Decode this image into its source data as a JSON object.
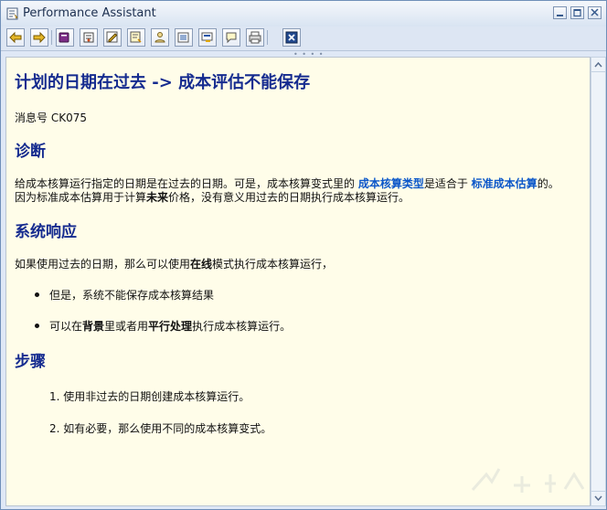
{
  "window": {
    "title": "Performance Assistant"
  },
  "toolbar": {
    "buttons": [
      {
        "name": "back-button",
        "icon": "left-arrow-icon"
      },
      {
        "name": "forward-button",
        "icon": "right-arrow-icon"
      },
      {
        "name": "bookmark-button",
        "icon": "book-icon"
      },
      {
        "name": "settings-button",
        "icon": "tools-icon"
      },
      {
        "name": "edit-button",
        "icon": "pencil-icon"
      },
      {
        "name": "notes-button",
        "icon": "note-icon"
      },
      {
        "name": "info-button",
        "icon": "person-icon"
      },
      {
        "name": "document-button",
        "icon": "doc-icon"
      },
      {
        "name": "link-button",
        "icon": "link-icon"
      },
      {
        "name": "message-button",
        "icon": "chat-icon"
      },
      {
        "name": "print-button",
        "icon": "printer-icon"
      },
      {
        "name": "close-button",
        "icon": "close-icon"
      }
    ]
  },
  "content": {
    "title": "计划的日期在过去 -> 成本评估不能保存",
    "message_id": "消息号 CK075",
    "diagnosis": {
      "heading": "诊断",
      "line1_pre": "给成本核算运行指定的日期是在过去的日期。可是，成本核算变式里的 ",
      "line1_link1": "成本核算类型",
      "line1_mid": "是适合于 ",
      "line1_link2": "标准成本估算",
      "line1_post": "的。",
      "line2_pre": "因为标准成本估算用于计算",
      "line2_bold": "未来",
      "line2_post": "价格，没有意义用过去的日期执行成本核算运行。"
    },
    "response": {
      "heading": "系统响应",
      "line_pre": "如果使用过去的日期，那么可以使用",
      "line_bold": "在线",
      "line_post": "模式执行成本核算运行，",
      "bullet1": "但是，系统不能保存成本核算结果",
      "bullet2_pre": "可以在",
      "bullet2_bold1": "背景",
      "bullet2_mid": "里或者用",
      "bullet2_bold2": "平行处理",
      "bullet2_post": "执行成本核算运行。"
    },
    "steps": {
      "heading": "步骤",
      "step1": "1. 使用非过去的日期创建成本核算运行。",
      "step2": "2. 如有必要，那么使用不同的成本核算变式。"
    }
  },
  "colors": {
    "heading": "#152b8f",
    "link": "#0b57c9",
    "content_bg": "#fffde9"
  }
}
